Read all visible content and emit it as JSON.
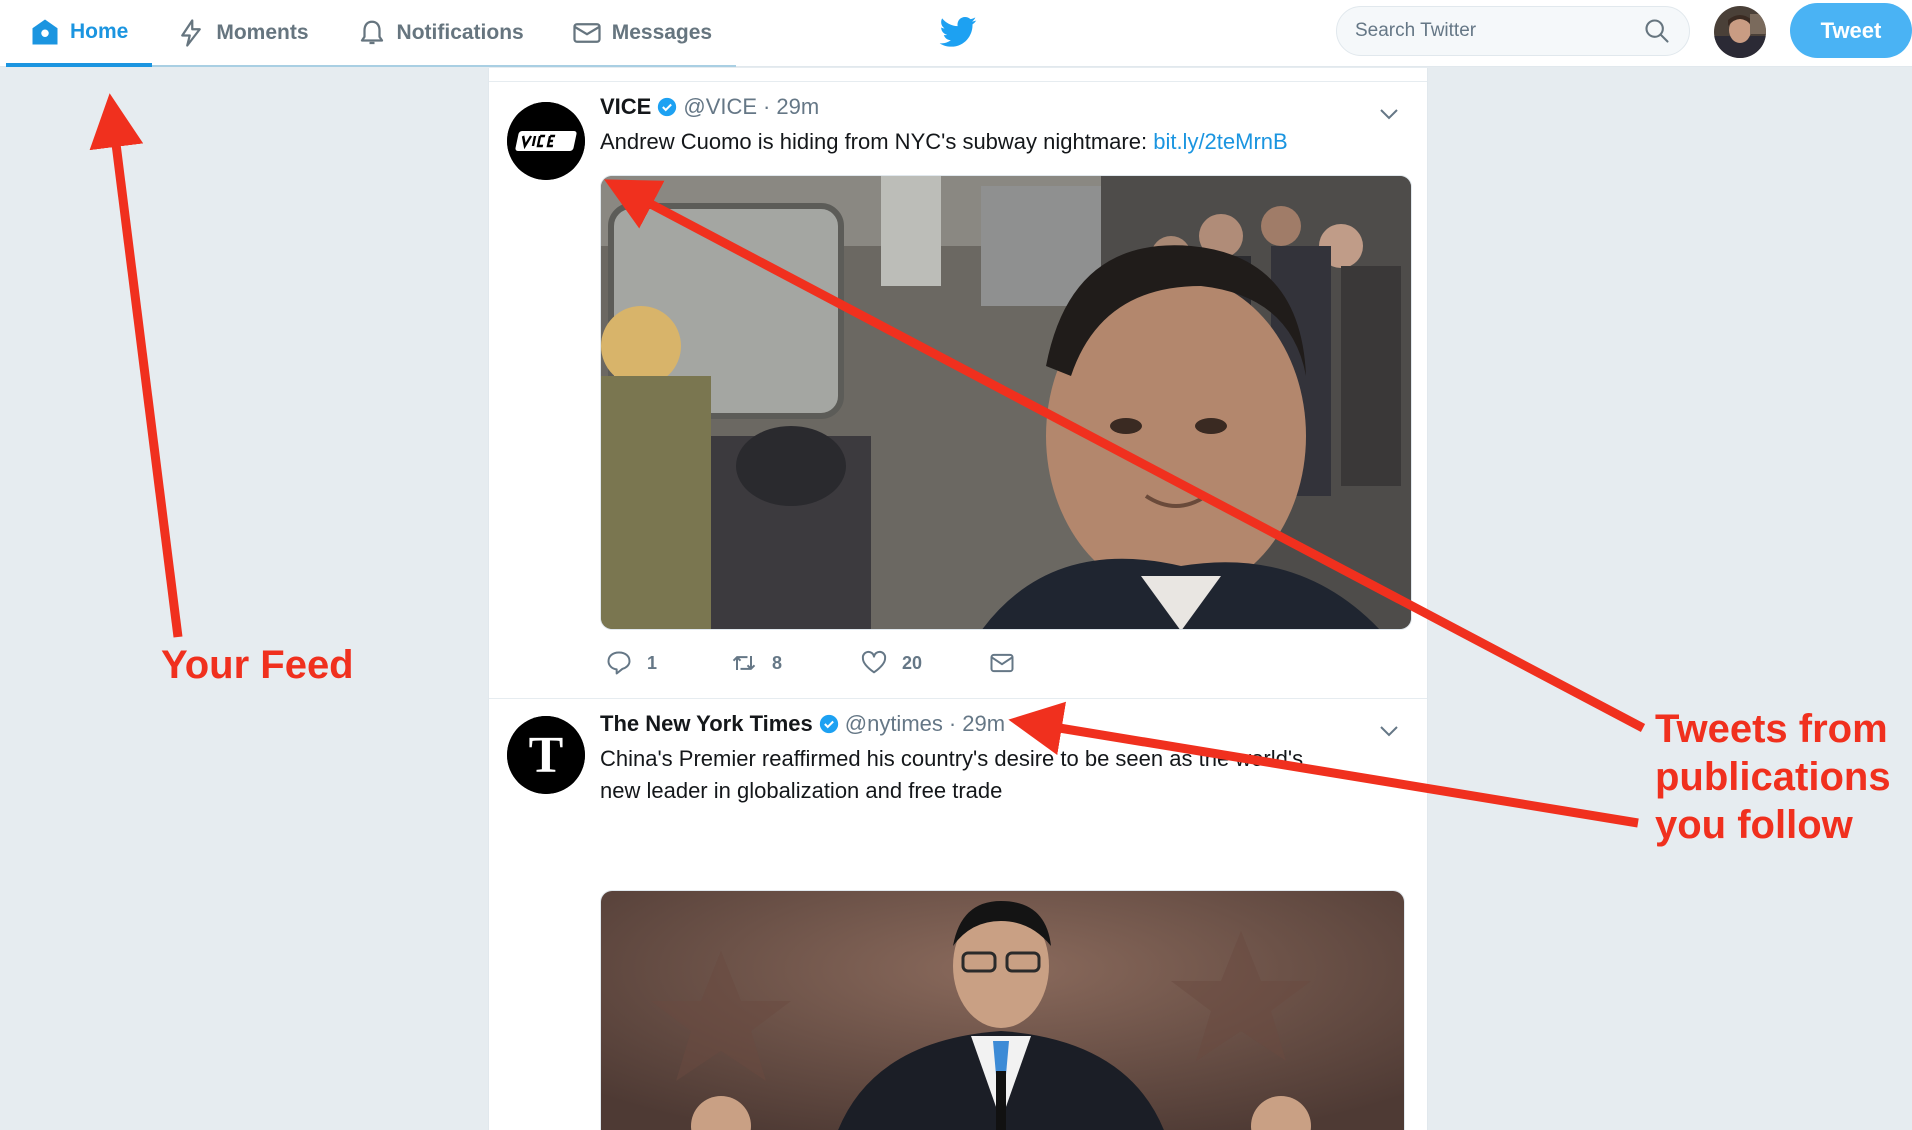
{
  "nav": {
    "items": [
      {
        "label": "Home",
        "icon": "home-icon",
        "active": true
      },
      {
        "label": "Moments",
        "icon": "lightning-icon",
        "active": false
      },
      {
        "label": "Notifications",
        "icon": "bell-icon",
        "active": false
      },
      {
        "label": "Messages",
        "icon": "envelope-icon",
        "active": false
      }
    ]
  },
  "search": {
    "placeholder": "Search Twitter"
  },
  "tweet_button": "Tweet",
  "colors": {
    "accent": "#1b95e0",
    "annotation": "#f0301e",
    "background": "#e6ecf0"
  },
  "tweets": [
    {
      "name": "VICE",
      "handle": "@VICE",
      "separator": "·",
      "time": "29m",
      "text": "Andrew Cuomo is hiding from NYC's subway nightmare: ",
      "link": "bit.ly/2teMrnB",
      "replies": "1",
      "retweets": "8",
      "likes": "20"
    },
    {
      "name": "The New York Times",
      "handle": "@nytimes",
      "separator": "·",
      "time": "29m",
      "text": "China's Premier reaffirmed his country's desire to be seen as the world's new leader in globalization and free trade"
    }
  ],
  "annotations": {
    "feed": "Your Feed",
    "publications": [
      "Tweets from",
      "publications",
      "you follow"
    ]
  }
}
